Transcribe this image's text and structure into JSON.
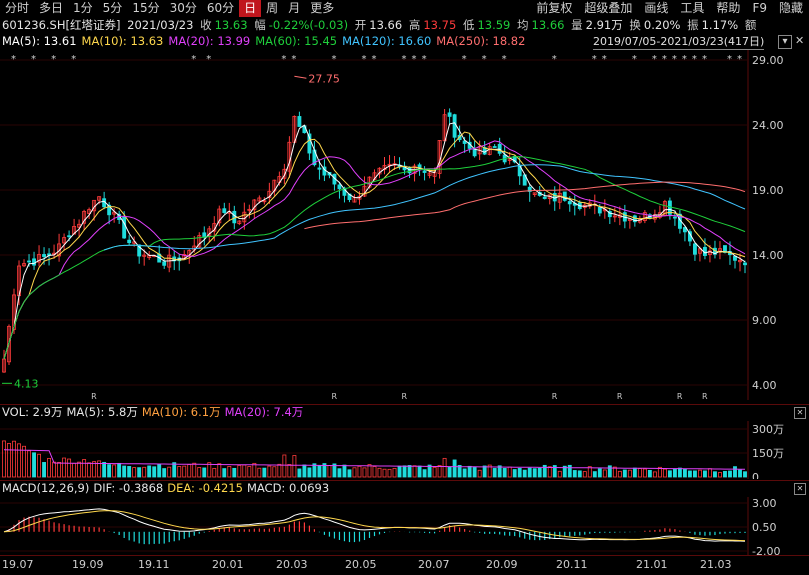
{
  "tabs": [
    "分时",
    "多日",
    "1分",
    "5分",
    "15分",
    "30分",
    "60分",
    "日",
    "周",
    "月",
    "更多"
  ],
  "active_tab": "日",
  "right_tabs": [
    "前复权",
    "超级叠加",
    "画线",
    "工具",
    "帮助",
    "F9",
    "隐藏"
  ],
  "quote": {
    "code": "601236.SH[红塔证券]",
    "date": "2021/03/23",
    "close_label": "收",
    "close": "13.63",
    "change_label": "幅",
    "change": "-0.22%(-0.03)",
    "open_label": "开",
    "open": "13.66",
    "high_label": "高",
    "high": "13.75",
    "low_label": "低",
    "low": "13.59",
    "avg_label": "均",
    "avg": "13.66",
    "volume_label": "量",
    "volume": "2.91万",
    "turnover_label": "换",
    "turnover": "0.20%",
    "amplitude_label": "振",
    "amplitude": "1.17%",
    "more": "额"
  },
  "ma_legend": [
    {
      "label": "MA(5): 13.61",
      "color": "#ffffff"
    },
    {
      "label": "MA(10): 13.63",
      "color": "#ffd84d"
    },
    {
      "label": "MA(20): 13.99",
      "color": "#e040fb"
    },
    {
      "label": "MA(60): 15.45",
      "color": "#1fcf3b"
    },
    {
      "label": "MA(120): 16.60",
      "color": "#40c4ff"
    },
    {
      "label": "MA(250): 18.82",
      "color": "#ff6e6e"
    }
  ],
  "range": {
    "text": "2019/07/05-2021/03/23(417日)",
    "button": "▾",
    "close": "✕"
  },
  "vol_legend": [
    {
      "label": "VOL: 2.9万",
      "color": "#e6e6e6"
    },
    {
      "label": "MA(5): 5.8万",
      "color": "#e6e6e6"
    },
    {
      "label": "MA(10): 6.1万",
      "color": "#ffa040"
    },
    {
      "label": "MA(20): 7.4万",
      "color": "#e040fb"
    }
  ],
  "macd_legend": [
    {
      "label": "MACD(12,26,9)",
      "color": "#e6e6e6"
    },
    {
      "label": "DIF: -0.3868",
      "color": "#e6e6e6"
    },
    {
      "label": "DEA: -0.4215",
      "color": "#ffd84d"
    },
    {
      "label": "MACD: 0.0693",
      "color": "#e6e6e6"
    }
  ],
  "chart_data": [
    {
      "type": "candlestick",
      "y_ticks": [
        "29.00",
        "24.00",
        "19.00",
        "14.00",
        "9.00",
        "4.00"
      ],
      "ylim": [
        4,
        29
      ],
      "annotations": [
        {
          "text": "27.75",
          "kind": "high"
        },
        {
          "text": "4.13",
          "kind": "low"
        }
      ],
      "series": [
        {
          "name": "MA(5)",
          "color": "#ffffff"
        },
        {
          "name": "MA(10)",
          "color": "#ffd84d"
        },
        {
          "name": "MA(20)",
          "color": "#e040fb"
        },
        {
          "name": "MA(60)",
          "color": "#1fcf3b"
        },
        {
          "name": "MA(120)",
          "color": "#40c4ff"
        },
        {
          "name": "MA(250)",
          "color": "#ff6e6e"
        }
      ],
      "close_path": [
        [
          0,
          6
        ],
        [
          2,
          11
        ],
        [
          3,
          13.2
        ],
        [
          5,
          13.5
        ],
        [
          8,
          13.8
        ],
        [
          11,
          14.6
        ],
        [
          13,
          15.8
        ],
        [
          15,
          16.6
        ],
        [
          17,
          17.8
        ],
        [
          19,
          18.5
        ],
        [
          21,
          17.5
        ],
        [
          23,
          16.3
        ],
        [
          25,
          15.0
        ],
        [
          27,
          14.2
        ],
        [
          30,
          13.8
        ],
        [
          32,
          13.5
        ],
        [
          34,
          13.6
        ],
        [
          36,
          14.0
        ],
        [
          38,
          15.0
        ],
        [
          40,
          15.5
        ],
        [
          42,
          16.8
        ],
        [
          44,
          17.5
        ],
        [
          46,
          16.5
        ],
        [
          48,
          17.2
        ],
        [
          50,
          18.0
        ],
        [
          52,
          18.5
        ],
        [
          54,
          19.8
        ],
        [
          56,
          21.0
        ],
        [
          58,
          24.5
        ],
        [
          60,
          23.0
        ],
        [
          62,
          21.0
        ],
        [
          64,
          20.2
        ],
        [
          66,
          19.5
        ],
        [
          68,
          18.8
        ],
        [
          70,
          18.2
        ],
        [
          72,
          19.5
        ],
        [
          74,
          20.0
        ],
        [
          76,
          20.5
        ],
        [
          78,
          20.8
        ],
        [
          80,
          20.5
        ],
        [
          82,
          21.0
        ],
        [
          84,
          20.6
        ],
        [
          86,
          20.2
        ],
        [
          88,
          25.0
        ],
        [
          90,
          23.5
        ],
        [
          92,
          22.5
        ],
        [
          94,
          22.0
        ],
        [
          96,
          21.8
        ],
        [
          98,
          22.2
        ],
        [
          100,
          21.5
        ],
        [
          102,
          20.8
        ],
        [
          104,
          19.8
        ],
        [
          106,
          18.6
        ],
        [
          108,
          18.2
        ],
        [
          110,
          18.4
        ],
        [
          112,
          18.5
        ],
        [
          114,
          18.2
        ],
        [
          116,
          17.8
        ],
        [
          118,
          17.6
        ],
        [
          120,
          17.5
        ],
        [
          122,
          17.2
        ],
        [
          124,
          17.0
        ],
        [
          126,
          16.8
        ],
        [
          128,
          17.0
        ],
        [
          130,
          17.4
        ],
        [
          132,
          18.0
        ],
        [
          134,
          17.0
        ],
        [
          136,
          15.8
        ],
        [
          138,
          14.5
        ],
        [
          140,
          14.0
        ],
        [
          142,
          14.2
        ],
        [
          144,
          14.0
        ],
        [
          146,
          13.8
        ],
        [
          148,
          13.63
        ]
      ]
    },
    {
      "type": "bar",
      "name": "VOL",
      "y_ticks": [
        "300万",
        "150万",
        "0"
      ],
      "ylim": [
        0,
        300
      ]
    },
    {
      "type": "bar",
      "name": "MACD",
      "y_ticks": [
        "3.00",
        "0.50",
        "-2.00"
      ],
      "ylim": [
        -2,
        3
      ]
    }
  ],
  "x_labels": [
    "19.07",
    "19.09",
    "19.11",
    "20.01",
    "20.03",
    "20.05",
    "20.07",
    "20.09",
    "20.11",
    "21.01",
    "21.03"
  ],
  "colors": {
    "up": "#ff3b3b",
    "down": "#1fdcdc",
    "grid": "#5a0a0a"
  }
}
